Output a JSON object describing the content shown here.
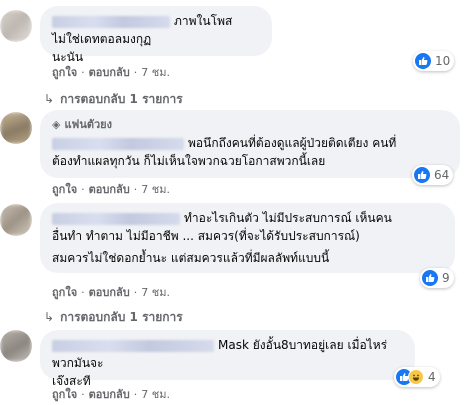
{
  "comments": [
    {
      "text": "ภาพในโพสไม่ใช่เดทตอลมงกุฏนะนัน",
      "line1": "ภาพในโพสไม่ใช่เดทตอลมงกุฏ",
      "line2": "นะนัน",
      "like_label": "ถูกใจ",
      "reply_label": "ตอบกลับ",
      "time": "7 ชม.",
      "reaction_count": "10",
      "replies_label": "การตอบกลับ 1 รายการ"
    },
    {
      "badge": "แฟนตัวยง",
      "line1": "พอนึกถึงคนที่ต้องดูแลผู้ป่วยติดเตียง คนที่",
      "line2": "ต้องทำแผลทุกวัน ก็ไม่เห็นใจพวกฉวยโอกาสพวกนี้เลย",
      "like_label": "ถูกใจ",
      "reply_label": "ตอบกลับ",
      "time": "7 ชม.",
      "reaction_count": "64"
    },
    {
      "line1": "ทำอะไรเกินตัว ไม่มีประสบการณ์ เห็นคน",
      "line2": "อื่นทำ ทำตาม ไม่มีอาชีพ ... สมควร(ที่จะได้รับประสบการณ์)",
      "line3": "สมควรไม่ใช่ดอกย้ำนะ แต่สมควรแล้วที่มีผลลัพท์แบบนี้",
      "like_label": "ถูกใจ",
      "reply_label": "ตอบกลับ",
      "time": "7 ชม.",
      "reaction_count": "9",
      "replies_label": "การตอบกลับ 1 รายการ"
    },
    {
      "line1": "Mask ยังอั้น8บาทอยู่เลย เมื่อไหร่พวกมันจะ",
      "line2": "เจ๊งสะที",
      "like_label": "ถูกใจ",
      "reply_label": "ตอบกลับ",
      "time": "7 ชม.",
      "reaction_count": "4"
    }
  ],
  "colors": {
    "bubble": "#f0f2f5",
    "meta": "#65676b",
    "like_blue": "#1877f2",
    "haha_yellow": "#f7c847"
  },
  "icons": [
    "like-icon",
    "haha-icon",
    "reply-arrow-icon",
    "diamond-badge-icon"
  ]
}
